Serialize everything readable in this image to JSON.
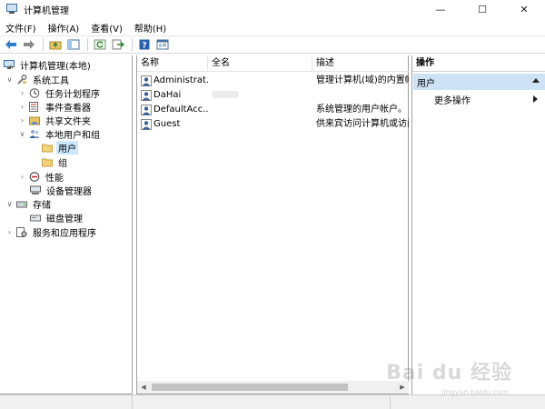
{
  "window": {
    "title": "计算机管理",
    "icon": "computer-management-icon",
    "controls": {
      "minimize": "—",
      "maximize": "☐",
      "close": "✕"
    }
  },
  "menubar": {
    "items": [
      {
        "label": "文件(F)"
      },
      {
        "label": "操作(A)"
      },
      {
        "label": "查看(V)"
      },
      {
        "label": "帮助(H)"
      }
    ]
  },
  "toolbar": {
    "buttons": [
      "back-arrow-icon",
      "forward-arrow-icon",
      "up-folder-icon",
      "show-hide-tree-icon",
      "refresh-icon",
      "export-list-icon",
      "help-icon",
      "properties-icon"
    ]
  },
  "tree": {
    "items": [
      {
        "label": "计算机管理(本地)",
        "icon": "computer-management-icon",
        "expand": "",
        "level": 0
      },
      {
        "label": "系统工具",
        "icon": "tools-icon",
        "expand": "∨",
        "level": 1
      },
      {
        "label": "任务计划程序",
        "icon": "clock-icon",
        "expand": "›",
        "level": 2
      },
      {
        "label": "事件查看器",
        "icon": "event-viewer-icon",
        "expand": "›",
        "level": 2
      },
      {
        "label": "共享文件夹",
        "icon": "shared-folder-icon",
        "expand": "›",
        "level": 2
      },
      {
        "label": "本地用户和组",
        "icon": "users-groups-icon",
        "expand": "∨",
        "level": 2
      },
      {
        "label": "用户",
        "icon": "folder-icon",
        "expand": "",
        "level": 3,
        "selected": true
      },
      {
        "label": "组",
        "icon": "folder-icon",
        "expand": "",
        "level": 3
      },
      {
        "label": "性能",
        "icon": "performance-icon",
        "expand": "›",
        "level": 2
      },
      {
        "label": "设备管理器",
        "icon": "device-manager-icon",
        "expand": "",
        "level": 2
      },
      {
        "label": "存储",
        "icon": "storage-icon",
        "expand": "∨",
        "level": 1
      },
      {
        "label": "磁盘管理",
        "icon": "disk-icon",
        "expand": "",
        "level": 2
      },
      {
        "label": "服务和应用程序",
        "icon": "services-icon",
        "expand": "›",
        "level": 1
      }
    ]
  },
  "list": {
    "columns": [
      "名称",
      "全名",
      "描述"
    ],
    "rows": [
      {
        "name": "Administrat...",
        "fullname": "",
        "desc": "管理计算机(域)的内置帐户",
        "redacted": false
      },
      {
        "name": "DaHai",
        "fullname": "",
        "desc": "",
        "redacted": true
      },
      {
        "name": "DefaultAcc...",
        "fullname": "",
        "desc": "系统管理的用户帐户。",
        "redacted": false
      },
      {
        "name": "Guest",
        "fullname": "",
        "desc": "供来宾访问计算机或访问域的内",
        "redacted": false
      }
    ]
  },
  "actions": {
    "header": "操作",
    "section": "用户",
    "more": "更多操作"
  },
  "watermark": {
    "text": "Bai du 经验",
    "sub": "jingyan.baidu.com"
  }
}
